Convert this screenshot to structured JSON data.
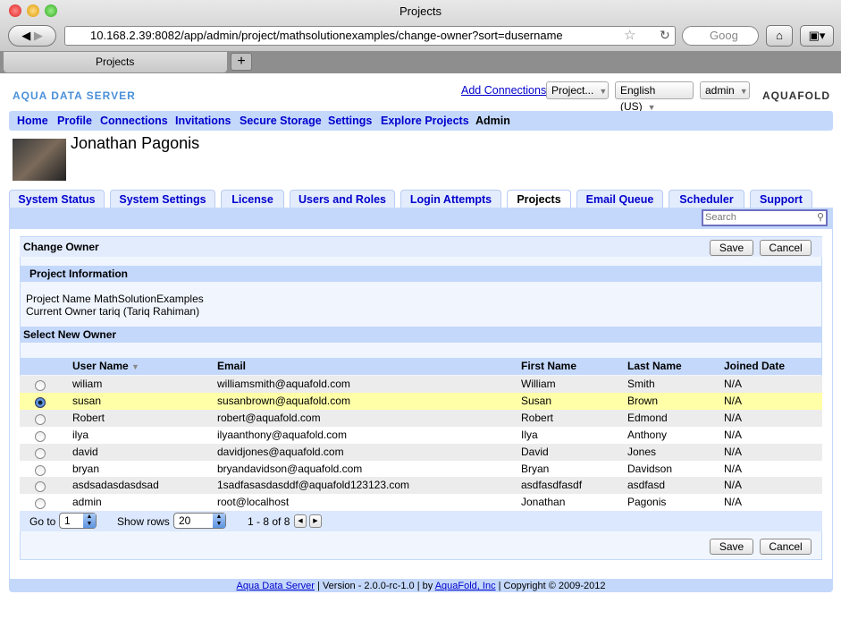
{
  "browser": {
    "window_title": "Projects",
    "url": "10.168.2.39:8082/app/admin/project/mathsolutionexamples/change-owner?sort=dusername",
    "search_placeholder": "Goog",
    "tab_title": "Projects",
    "new_tab": "+"
  },
  "header": {
    "logo_left": "AQUA DATA SERVER",
    "logo_right": "AQUAFOLD",
    "add_connections": "Add Connections",
    "project_select": "Project...",
    "language_select": "English (US)",
    "user_select": "admin"
  },
  "nav": [
    "Home",
    "Profile",
    "Connections",
    "Invitations",
    "Secure Storage",
    "Settings",
    "Explore Projects",
    "Admin"
  ],
  "user": {
    "name": "Jonathan Pagonis"
  },
  "tabs": [
    "System Status",
    "System Settings",
    "License",
    "Users and Roles",
    "Login Attempts",
    "Projects",
    "Email Queue",
    "Scheduler",
    "Support"
  ],
  "active_tab": "Projects",
  "search": {
    "placeholder": "Search"
  },
  "change_owner": {
    "title": "Change Owner",
    "save": "Save",
    "cancel": "Cancel",
    "project_info_title": "Project Information",
    "project_name": "Project Name MathSolutionExamples",
    "current_owner": "Current Owner tariq (Tariq Rahiman)",
    "select_title": "Select New Owner"
  },
  "table": {
    "columns": [
      "User Name",
      "Email",
      "First Name",
      "Last Name",
      "Joined Date"
    ],
    "sort_column": "User Name",
    "selected_index": 1,
    "rows": [
      [
        "wiliam",
        "williamsmith@aquafold.com",
        "William",
        "Smith",
        "N/A"
      ],
      [
        "susan",
        "susanbrown@aquafold.com",
        "Susan",
        "Brown",
        "N/A"
      ],
      [
        "Robert",
        "robert@aquafold.com",
        "Robert",
        "Edmond",
        "N/A"
      ],
      [
        "ilya",
        "ilyaanthony@aquafold.com",
        "Ilya",
        "Anthony",
        "N/A"
      ],
      [
        "david",
        "davidjones@aquafold.com",
        "David",
        "Jones",
        "N/A"
      ],
      [
        "bryan",
        "bryandavidson@aquafold.com",
        "Bryan",
        "Davidson",
        "N/A"
      ],
      [
        "asdsadasdasdsad",
        "1sadfasasdasddf@aquafold123123.com",
        "asdfasdfasdf",
        "asdfasd",
        "N/A"
      ],
      [
        "admin",
        "root@localhost",
        "Jonathan",
        "Pagonis",
        "N/A"
      ]
    ]
  },
  "pager": {
    "goto_label": "Go to",
    "goto_value": "1",
    "rows_label": "Show rows",
    "rows_value": "20",
    "range": "1 - 8 of 8"
  },
  "footer": {
    "product_link": "Aqua Data Server",
    "version": "| Version - 2.0.0-rc-1.0 | by",
    "company_link": "AquaFold, Inc",
    "copyright": "| Copyright © 2009-2012"
  },
  "colors": {
    "accent": "#c4d8fb",
    "link": "#0000cc",
    "selected_row": "#ffffa8"
  }
}
